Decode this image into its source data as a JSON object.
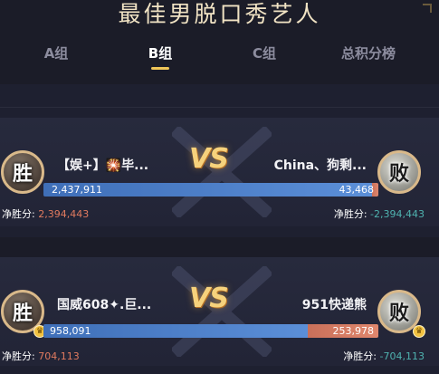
{
  "page": {
    "title": "最佳男脱口秀艺人",
    "tabs": [
      {
        "label": "A组",
        "active": false
      },
      {
        "label": "B组",
        "active": true
      },
      {
        "label": "C组",
        "active": false
      },
      {
        "label": "总积分榜",
        "active": false
      }
    ]
  },
  "matches": [
    {
      "left": {
        "name": "【娱+】🎇毕...",
        "result": "胜",
        "votes": "2,437,911",
        "net_label": "净胜分:",
        "net_value": "2,394,443"
      },
      "right": {
        "name": "China、狗剩...",
        "result": "败",
        "votes": "43,468",
        "net_label": "净胜分:",
        "net_value": "-2,394,443"
      },
      "vs_text": "VS",
      "left_share_percent": 98.2
    },
    {
      "left": {
        "name": "国威608✦.巨...",
        "result": "胜",
        "votes": "958,091",
        "net_label": "净胜分:",
        "net_value": "704,113"
      },
      "right": {
        "name": "951快递熊",
        "result": "败",
        "votes": "253,978",
        "net_label": "净胜分:",
        "net_value": "-704,113"
      },
      "vs_text": "VS",
      "left_share_percent": 79.0
    }
  ],
  "colors": {
    "accent_gold": "#f0c659",
    "left_bar": "#4a7cc4",
    "right_bar": "#d87c63",
    "positive": "#e07a5f",
    "negative": "#4fb3b0"
  },
  "icons": {
    "badge": "crown-icon"
  }
}
